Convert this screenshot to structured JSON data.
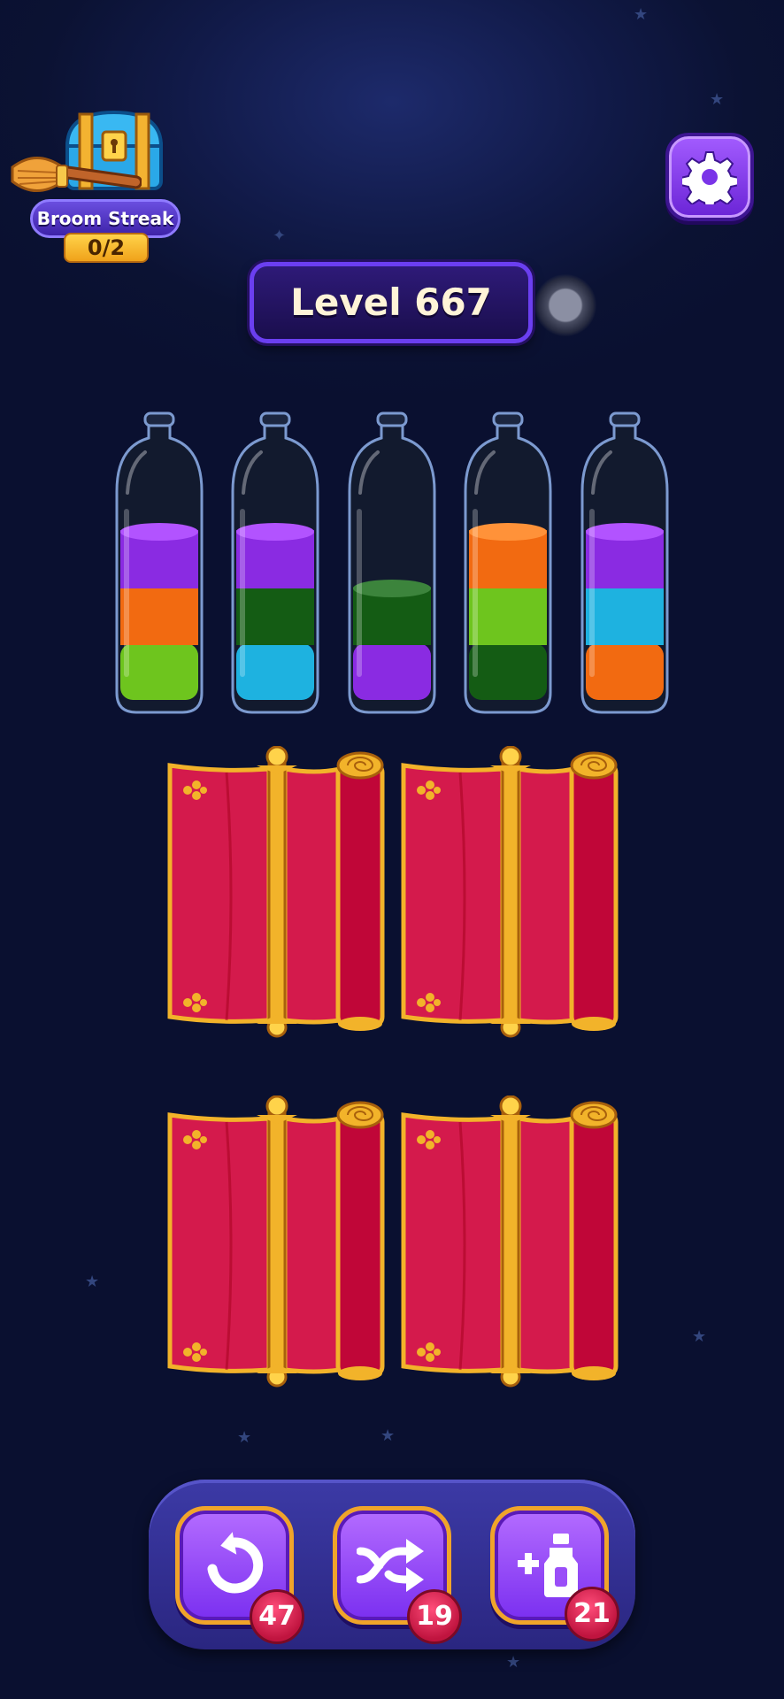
{
  "hud": {
    "streak_title": "Broom Streak",
    "streak_count": "0/2",
    "level_label": "Level 667"
  },
  "colors": {
    "purple": "#8a2be2",
    "orange": "#f26a11",
    "lime": "#6ec51e",
    "dark_green": "#145c14",
    "sky_blue": "#1eb2e0",
    "curtain_red": "#d41a4c",
    "gold": "#f2b32a"
  },
  "bottles": [
    {
      "layers_top_to_bottom": [
        "purple",
        "orange",
        "lime"
      ]
    },
    {
      "layers_top_to_bottom": [
        "purple",
        "dark_green",
        "sky_blue"
      ]
    },
    {
      "layers_top_to_bottom": [
        "dark_green",
        "purple"
      ]
    },
    {
      "layers_top_to_bottom": [
        "orange",
        "lime",
        "dark_green"
      ]
    },
    {
      "layers_top_to_bottom": [
        "purple",
        "sky_blue",
        "orange"
      ]
    }
  ],
  "curtains_count": 4,
  "tools": [
    {
      "name": "undo",
      "icon": "undo-arrow-icon",
      "count": "47"
    },
    {
      "name": "shuffle",
      "icon": "shuffle-icon",
      "count": "19"
    },
    {
      "name": "add-bottle",
      "icon": "add-bottle-icon",
      "count": "21"
    }
  ]
}
